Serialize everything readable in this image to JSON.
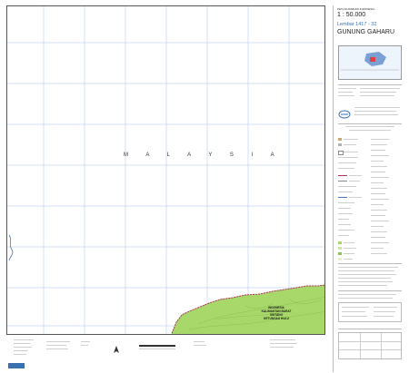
{
  "header": {
    "series": "PETA RUPABUMI INDONESIA",
    "scale": "1 : 50.000",
    "sheet": "Lembar 1417 - 32",
    "title": "GUNUNG GAHARU"
  },
  "map": {
    "country_label": "M A L A Y S I A",
    "region_label_lines": [
      "INDONESIA",
      "KALIMANTAN BARAT",
      "SINTANG",
      "KETUNGAU HULU"
    ]
  },
  "colors": {
    "forest": "#a8d86a",
    "forest_dark": "#8cc456",
    "boundary": "#b03060",
    "water": "#4a78c0",
    "grid": "#a8c4e8",
    "sheet_number": "#3a6fb0"
  },
  "icons": [
    "north-arrow-icon",
    "logo-icon"
  ]
}
